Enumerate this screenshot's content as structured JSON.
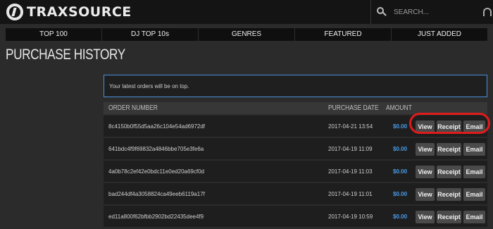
{
  "header": {
    "logo_text": "TRAXSOURCE",
    "search_placeholder": "SEARCH..."
  },
  "nav": {
    "items": [
      "TOP 100",
      "DJ TOP 10s",
      "GENRES",
      "FEATURED",
      "JUST ADDED"
    ]
  },
  "page_title": "PURCHASE HISTORY",
  "notice": "Your latest orders will be on top.",
  "table": {
    "columns": {
      "order_number": "ORDER NUMBER",
      "purchase_date": "PURCHASE DATE",
      "amount": "AMOUNT"
    },
    "actions": {
      "view": "View",
      "receipt": "Receipt",
      "email": "Email"
    },
    "rows": [
      {
        "order": "8c4150b0f55d5aa26c104e54ad6972df",
        "date": "2017-04-21 13:54",
        "amount": "$0.00"
      },
      {
        "order": "641bdc4f9f69832a4846bbe705e3fe6a",
        "date": "2017-04-19 11:09",
        "amount": "$0.00"
      },
      {
        "order": "4a0b78c2ef42e0bdc11e0ed20a69cf0d",
        "date": "2017-04-19 11:03",
        "amount": "$0.00"
      },
      {
        "order": "bad244df4a3058824ca49eeb6119a17f",
        "date": "2017-04-19 11:01",
        "amount": "$0.00"
      },
      {
        "order": "ed11a800f62bfbb2902bd22435dee4f9",
        "date": "2017-04-19 10:59",
        "amount": "$0.00"
      }
    ]
  },
  "colors": {
    "accent_blue": "#4a9be8",
    "highlight_red": "#e01b1b"
  }
}
